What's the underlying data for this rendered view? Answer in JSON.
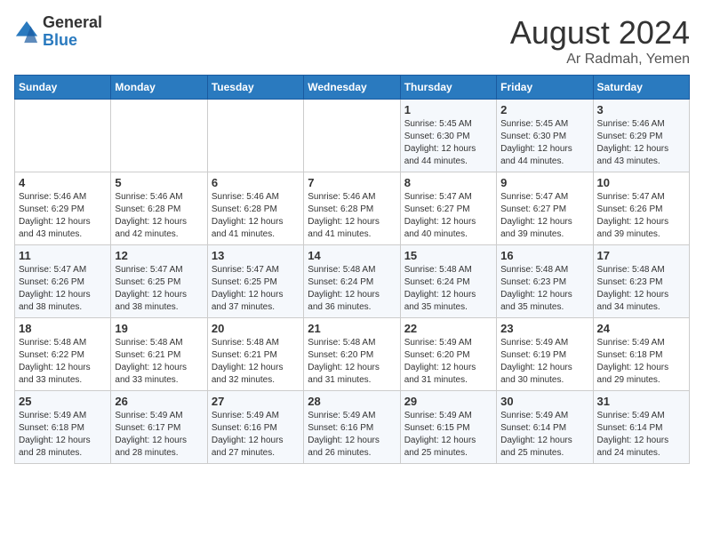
{
  "logo": {
    "general": "General",
    "blue": "Blue"
  },
  "header": {
    "month_year": "August 2024",
    "location": "Ar Radmah, Yemen"
  },
  "weekdays": [
    "Sunday",
    "Monday",
    "Tuesday",
    "Wednesday",
    "Thursday",
    "Friday",
    "Saturday"
  ],
  "weeks": [
    [
      {
        "day": "",
        "info": ""
      },
      {
        "day": "",
        "info": ""
      },
      {
        "day": "",
        "info": ""
      },
      {
        "day": "",
        "info": ""
      },
      {
        "day": "1",
        "info": "Sunrise: 5:45 AM\nSunset: 6:30 PM\nDaylight: 12 hours\nand 44 minutes."
      },
      {
        "day": "2",
        "info": "Sunrise: 5:45 AM\nSunset: 6:30 PM\nDaylight: 12 hours\nand 44 minutes."
      },
      {
        "day": "3",
        "info": "Sunrise: 5:46 AM\nSunset: 6:29 PM\nDaylight: 12 hours\nand 43 minutes."
      }
    ],
    [
      {
        "day": "4",
        "info": "Sunrise: 5:46 AM\nSunset: 6:29 PM\nDaylight: 12 hours\nand 43 minutes."
      },
      {
        "day": "5",
        "info": "Sunrise: 5:46 AM\nSunset: 6:28 PM\nDaylight: 12 hours\nand 42 minutes."
      },
      {
        "day": "6",
        "info": "Sunrise: 5:46 AM\nSunset: 6:28 PM\nDaylight: 12 hours\nand 41 minutes."
      },
      {
        "day": "7",
        "info": "Sunrise: 5:46 AM\nSunset: 6:28 PM\nDaylight: 12 hours\nand 41 minutes."
      },
      {
        "day": "8",
        "info": "Sunrise: 5:47 AM\nSunset: 6:27 PM\nDaylight: 12 hours\nand 40 minutes."
      },
      {
        "day": "9",
        "info": "Sunrise: 5:47 AM\nSunset: 6:27 PM\nDaylight: 12 hours\nand 39 minutes."
      },
      {
        "day": "10",
        "info": "Sunrise: 5:47 AM\nSunset: 6:26 PM\nDaylight: 12 hours\nand 39 minutes."
      }
    ],
    [
      {
        "day": "11",
        "info": "Sunrise: 5:47 AM\nSunset: 6:26 PM\nDaylight: 12 hours\nand 38 minutes."
      },
      {
        "day": "12",
        "info": "Sunrise: 5:47 AM\nSunset: 6:25 PM\nDaylight: 12 hours\nand 38 minutes."
      },
      {
        "day": "13",
        "info": "Sunrise: 5:47 AM\nSunset: 6:25 PM\nDaylight: 12 hours\nand 37 minutes."
      },
      {
        "day": "14",
        "info": "Sunrise: 5:48 AM\nSunset: 6:24 PM\nDaylight: 12 hours\nand 36 minutes."
      },
      {
        "day": "15",
        "info": "Sunrise: 5:48 AM\nSunset: 6:24 PM\nDaylight: 12 hours\nand 35 minutes."
      },
      {
        "day": "16",
        "info": "Sunrise: 5:48 AM\nSunset: 6:23 PM\nDaylight: 12 hours\nand 35 minutes."
      },
      {
        "day": "17",
        "info": "Sunrise: 5:48 AM\nSunset: 6:23 PM\nDaylight: 12 hours\nand 34 minutes."
      }
    ],
    [
      {
        "day": "18",
        "info": "Sunrise: 5:48 AM\nSunset: 6:22 PM\nDaylight: 12 hours\nand 33 minutes."
      },
      {
        "day": "19",
        "info": "Sunrise: 5:48 AM\nSunset: 6:21 PM\nDaylight: 12 hours\nand 33 minutes."
      },
      {
        "day": "20",
        "info": "Sunrise: 5:48 AM\nSunset: 6:21 PM\nDaylight: 12 hours\nand 32 minutes."
      },
      {
        "day": "21",
        "info": "Sunrise: 5:48 AM\nSunset: 6:20 PM\nDaylight: 12 hours\nand 31 minutes."
      },
      {
        "day": "22",
        "info": "Sunrise: 5:49 AM\nSunset: 6:20 PM\nDaylight: 12 hours\nand 31 minutes."
      },
      {
        "day": "23",
        "info": "Sunrise: 5:49 AM\nSunset: 6:19 PM\nDaylight: 12 hours\nand 30 minutes."
      },
      {
        "day": "24",
        "info": "Sunrise: 5:49 AM\nSunset: 6:18 PM\nDaylight: 12 hours\nand 29 minutes."
      }
    ],
    [
      {
        "day": "25",
        "info": "Sunrise: 5:49 AM\nSunset: 6:18 PM\nDaylight: 12 hours\nand 28 minutes."
      },
      {
        "day": "26",
        "info": "Sunrise: 5:49 AM\nSunset: 6:17 PM\nDaylight: 12 hours\nand 28 minutes."
      },
      {
        "day": "27",
        "info": "Sunrise: 5:49 AM\nSunset: 6:16 PM\nDaylight: 12 hours\nand 27 minutes."
      },
      {
        "day": "28",
        "info": "Sunrise: 5:49 AM\nSunset: 6:16 PM\nDaylight: 12 hours\nand 26 minutes."
      },
      {
        "day": "29",
        "info": "Sunrise: 5:49 AM\nSunset: 6:15 PM\nDaylight: 12 hours\nand 25 minutes."
      },
      {
        "day": "30",
        "info": "Sunrise: 5:49 AM\nSunset: 6:14 PM\nDaylight: 12 hours\nand 25 minutes."
      },
      {
        "day": "31",
        "info": "Sunrise: 5:49 AM\nSunset: 6:14 PM\nDaylight: 12 hours\nand 24 minutes."
      }
    ]
  ]
}
